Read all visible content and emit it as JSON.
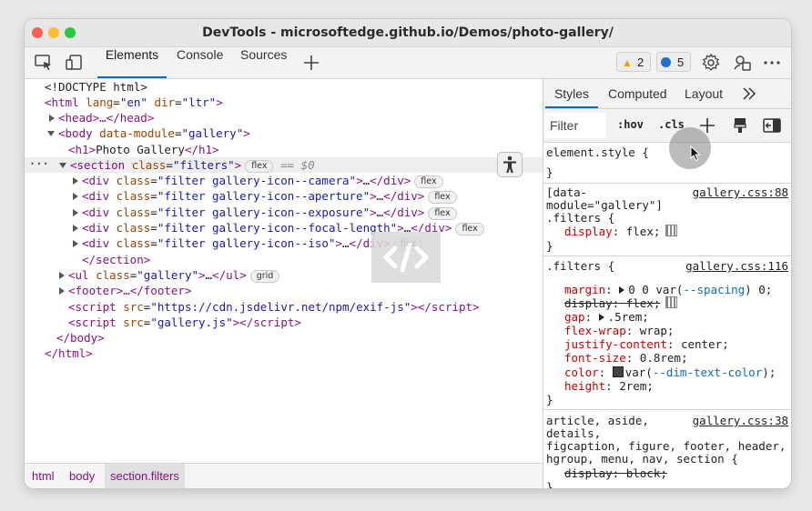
{
  "window": {
    "title": "DevTools - microsoftedge.github.io/Demos/photo-gallery/"
  },
  "toolbar": {
    "tabs": [
      "Elements",
      "Console",
      "Sources"
    ],
    "warnings_count": "2",
    "messages_count": "5",
    "icons": [
      "inspect-icon",
      "device-icon",
      "add-tab-icon",
      "settings-icon",
      "connect-icon",
      "more-icon"
    ]
  },
  "dom_tree": {
    "doctype": "<!DOCTYPE html>",
    "html_open": {
      "tag": "html",
      "attrs": "lang=\"en\" dir=\"ltr\""
    },
    "head": "<head>…</head>",
    "body_open": {
      "tag": "body",
      "attr_name": "data-module",
      "attr_value": "\"gallery\""
    },
    "h1": {
      "text": "Photo Gallery"
    },
    "section": {
      "attr_value": "\"filters\"",
      "badge": "flex",
      "eq": "== $0"
    },
    "divs": [
      {
        "value": "\"filter gallery-icon--camera\"",
        "badge": "flex"
      },
      {
        "value": "\"filter gallery-icon--aperture\"",
        "badge": "flex"
      },
      {
        "value": "\"filter gallery-icon--exposure\"",
        "badge": "flex"
      },
      {
        "value": "\"filter gallery-icon--focal-length\"",
        "badge": "flex"
      },
      {
        "value": "\"filter gallery-icon--iso\"",
        "badge": "flex"
      }
    ],
    "section_close": "</section>",
    "ul": {
      "attr_value": "\"gallery\"",
      "badge": "grid"
    },
    "footer": "<footer>…</footer>",
    "script1_src": "\"https://cdn.jsdelivr.net/npm/exif-js\"",
    "script2_src": "\"gallery.js\"",
    "body_close": "</body>",
    "html_close": "</html>"
  },
  "breadcrumbs": [
    "html",
    "body",
    "section.filters"
  ],
  "styles_pane": {
    "tabs": [
      "Styles",
      "Computed",
      "Layout"
    ],
    "filter_placeholder": "Filter",
    "hov": ":hov",
    "cls": ".cls",
    "rules": {
      "element_style": "element.style {",
      "r1_sel_a": "[data-",
      "r1_sel_b": "module=\"gallery\"]",
      "r1_sel_c": ".filters {",
      "r1_src": "gallery.css:88",
      "r1_prop": "display",
      "r1_val": "flex;",
      "r2_sel": ".filters {",
      "r2_src": "gallery.css:116",
      "margin": "margin",
      "margin_val_a": "0 0 var(",
      "margin_var": "--spacing",
      "margin_val_b": ") 0;",
      "display_struck": "display: flex;",
      "gap": "gap",
      "gap_val": ".5rem;",
      "flex_wrap": "flex-wrap",
      "flex_wrap_val": "wrap;",
      "justify": "justify-content",
      "justify_val": "center;",
      "font_size": "font-size",
      "font_size_val": "0.8rem;",
      "color": "color",
      "color_val_a": "var(",
      "color_var": "--dim-text-color",
      "color_val_b": ");",
      "height": "height",
      "height_val": "2rem;",
      "r3_sel_a": "article, aside,",
      "r3_sel_b": "details,",
      "r3_sel_c": "figcaption, figure, footer, header,",
      "r3_sel_d": "hgroup, menu, nav, section {",
      "r3_src": "gallery.css:38",
      "r3_struck": "display: block;",
      "close": "}"
    }
  },
  "colors": {
    "accent": "#0f6cbd",
    "tag": "#881280",
    "attr_name": "#994500",
    "attr_value": "#1a1aa6"
  }
}
